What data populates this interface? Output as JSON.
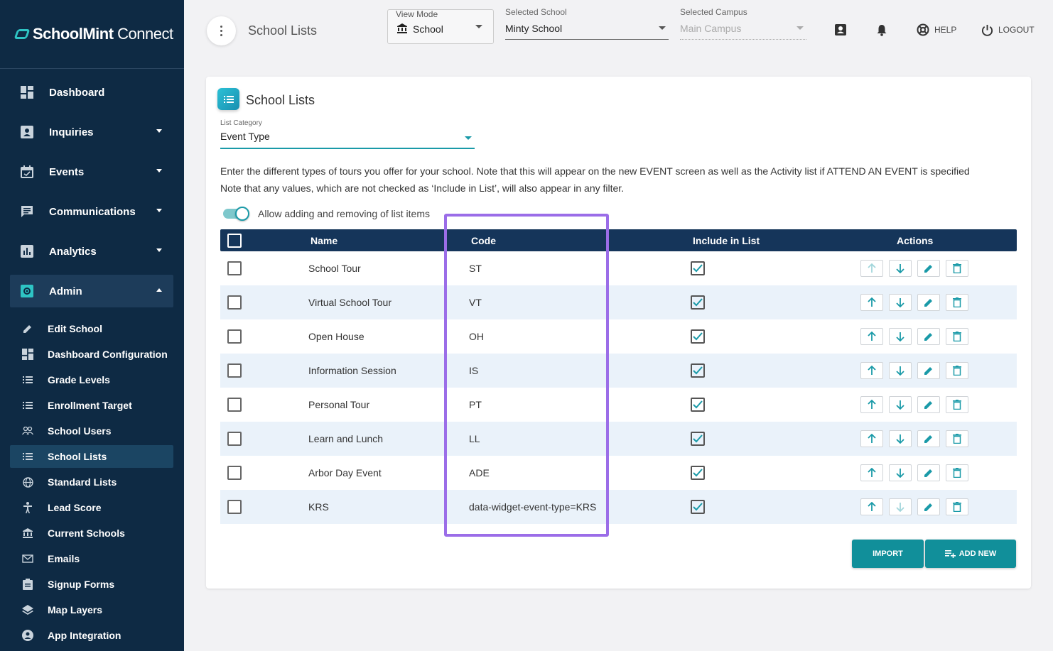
{
  "brand": {
    "bold": "SchoolMint",
    "light": " Connect"
  },
  "nav": [
    {
      "label": "Dashboard",
      "icon": "dashboard-icon",
      "caret": false
    },
    {
      "label": "Inquiries",
      "icon": "inquiries-icon",
      "caret": true
    },
    {
      "label": "Events",
      "icon": "calendar-icon",
      "caret": true
    },
    {
      "label": "Communications",
      "icon": "chat-icon",
      "caret": true
    },
    {
      "label": "Analytics",
      "icon": "analytics-icon",
      "caret": true
    },
    {
      "label": "Admin",
      "icon": "gear-icon",
      "caret": true,
      "expanded": true
    }
  ],
  "admin_sub": [
    {
      "label": "Edit School",
      "icon": "pencil-icon"
    },
    {
      "label": "Dashboard Configuration",
      "icon": "dashboard-icon"
    },
    {
      "label": "Grade Levels",
      "icon": "list-icon"
    },
    {
      "label": "Enrollment Target",
      "icon": "list-icon"
    },
    {
      "label": "School Users",
      "icon": "users-icon"
    },
    {
      "label": "School Lists",
      "icon": "list-icon",
      "active": true
    },
    {
      "label": "Standard Lists",
      "icon": "globe-icon"
    },
    {
      "label": "Lead Score",
      "icon": "person-icon"
    },
    {
      "label": "Current Schools",
      "icon": "bank-icon"
    },
    {
      "label": "Emails",
      "icon": "mail-icon"
    },
    {
      "label": "Signup Forms",
      "icon": "clipboard-icon"
    },
    {
      "label": "Map Layers",
      "icon": "layers-icon"
    },
    {
      "label": "App Integration",
      "icon": "account-icon"
    }
  ],
  "topbar": {
    "page_title": "School Lists",
    "view_mode": {
      "label": "View Mode",
      "value": "School"
    },
    "selected_school": {
      "label": "Selected School",
      "value": "Minty School"
    },
    "selected_campus": {
      "label": "Selected Campus",
      "value": "Main Campus"
    },
    "help": "HELP",
    "logout": "LOGOUT"
  },
  "card": {
    "title": "School Lists",
    "category_label": "List Category",
    "category_value": "Event Type",
    "desc1": "Enter the different types of tours you offer for your school. Note that this will appear on the new EVENT screen as well as the Activity list if ATTEND AN EVENT is specified",
    "desc2": "Note that any values, which are not checked as ‘Include in List’, will also appear in any filter.",
    "toggle_label": "Allow adding and removing of list items",
    "toggle_on": true
  },
  "table": {
    "headers": {
      "name": "Name",
      "code": "Code",
      "include": "Include in List",
      "actions": "Actions"
    },
    "rows": [
      {
        "name": "School Tour",
        "code": "ST",
        "include": true
      },
      {
        "name": "Virtual School Tour",
        "code": "VT",
        "include": true
      },
      {
        "name": "Open House",
        "code": "OH",
        "include": true
      },
      {
        "name": "Information Session",
        "code": "IS",
        "include": true
      },
      {
        "name": "Personal Tour",
        "code": "PT",
        "include": true
      },
      {
        "name": "Learn and Lunch",
        "code": "LL",
        "include": true
      },
      {
        "name": "Arbor Day Event",
        "code": "ADE",
        "include": true
      },
      {
        "name": "KRS",
        "code": "data-widget-event-type=KRS",
        "include": true
      }
    ]
  },
  "buttons": {
    "import": "IMPORT",
    "add_new": "ADD NEW"
  },
  "colors": {
    "sidebar": "#0e2a44",
    "accent": "#118f9a",
    "table_header": "#15355a",
    "highlight": "#9b6de8"
  }
}
